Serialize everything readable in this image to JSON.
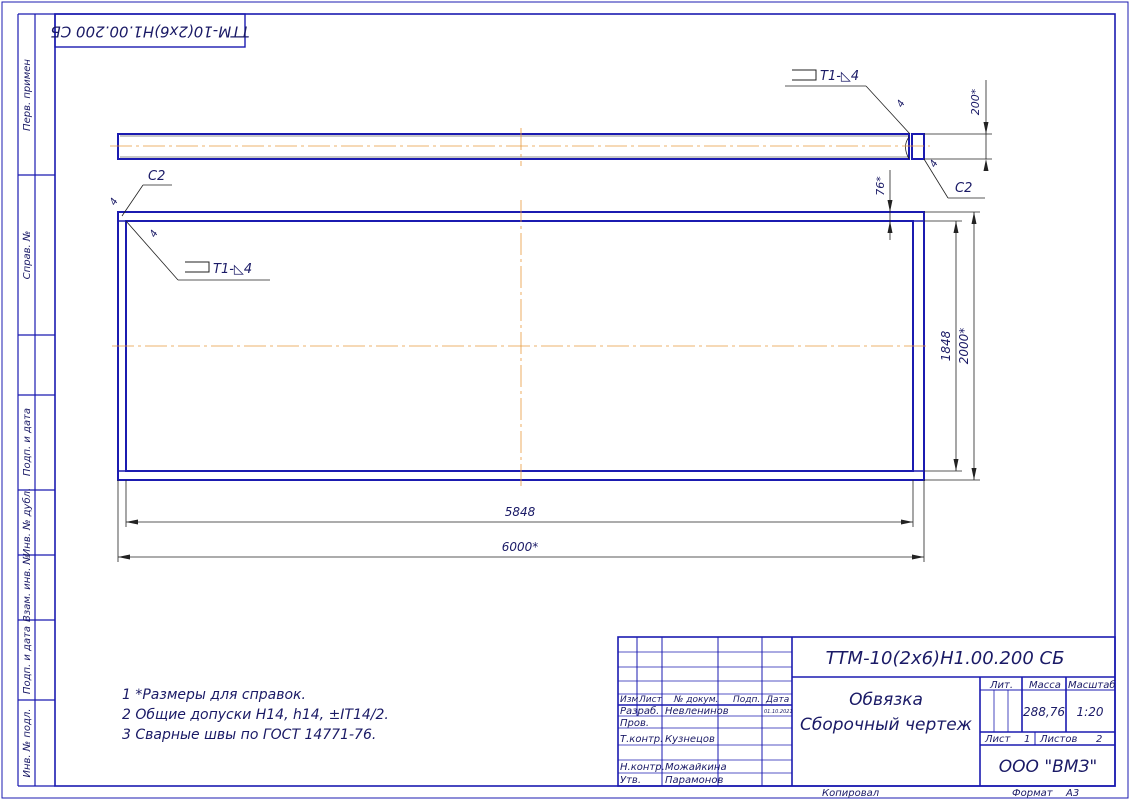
{
  "drawing": {
    "designation": "ТТМ-10(2х6)Н1.00.200 СБ",
    "designation_mirrored": "ТТМ-10(2х6)Н1.00.200 СБ",
    "title_line1": "Обвязка",
    "title_line2": "Сборочный чертеж",
    "organization": "ООО \"ВМЗ\""
  },
  "side_stamp": {
    "perv_primen": "Перв. примен",
    "sprav_no": "Справ. №",
    "podp_data_1": "Подп. и дата",
    "inv_dubl": "Инв. № дубл.",
    "vzam_inv": "Взам. инв. №",
    "podp_data_2": "Подп. и дата",
    "inv_podl": "Инв. № подл."
  },
  "title_block": {
    "col_izm": "Изм",
    "col_list": "Лист",
    "col_doc": "№ докум.",
    "col_podp": "Подп.",
    "col_data": "Дата",
    "razrab_label": "Разраб.",
    "razrab_name": "Невленинов",
    "razrab_date": "01.10.2021",
    "prov_label": "Пров.",
    "tkontr_label": "Т.контр.",
    "tkontr_name": "Кузнецов",
    "nkontr_label": "Н.контр.",
    "nkontr_name": "Можайкина",
    "utv_label": "Утв.",
    "utv_name": "Парамонов",
    "lit_label": "Лит.",
    "massa_label": "Масса",
    "massa_value": "288,76",
    "masshtab_label": "Масштаб",
    "masshtab_value": "1:20",
    "list_label": "Лист",
    "list_value": "1",
    "listov_label": "Листов",
    "listov_value": "2",
    "kopiroval": "Копировал",
    "format_label": "Формат",
    "format_value": "А3"
  },
  "notes": [
    "1  *Размеры для справок.",
    "2  Общие допуски Н14, h14, ±IT14/2.",
    "3  Сварные швы по ГОСТ 14771-76."
  ],
  "dimensions": {
    "len_inner": "5848",
    "len_total": "6000*",
    "h_inner": "1848",
    "h_total": "2000*",
    "profile_h": "200*",
    "profile_w": "76*"
  },
  "weld": {
    "label_top": "Т1-◺4",
    "label_left": "Т1-◺4",
    "leg_a": "4",
    "leg_b": "4",
    "leg_c": "4",
    "leg_d": "4",
    "chamfer_left": "С2",
    "chamfer_right": "С2"
  },
  "colors": {
    "frame": "#1b1bb0",
    "center_line": "#e89a3c",
    "text": "#1a1a66"
  }
}
